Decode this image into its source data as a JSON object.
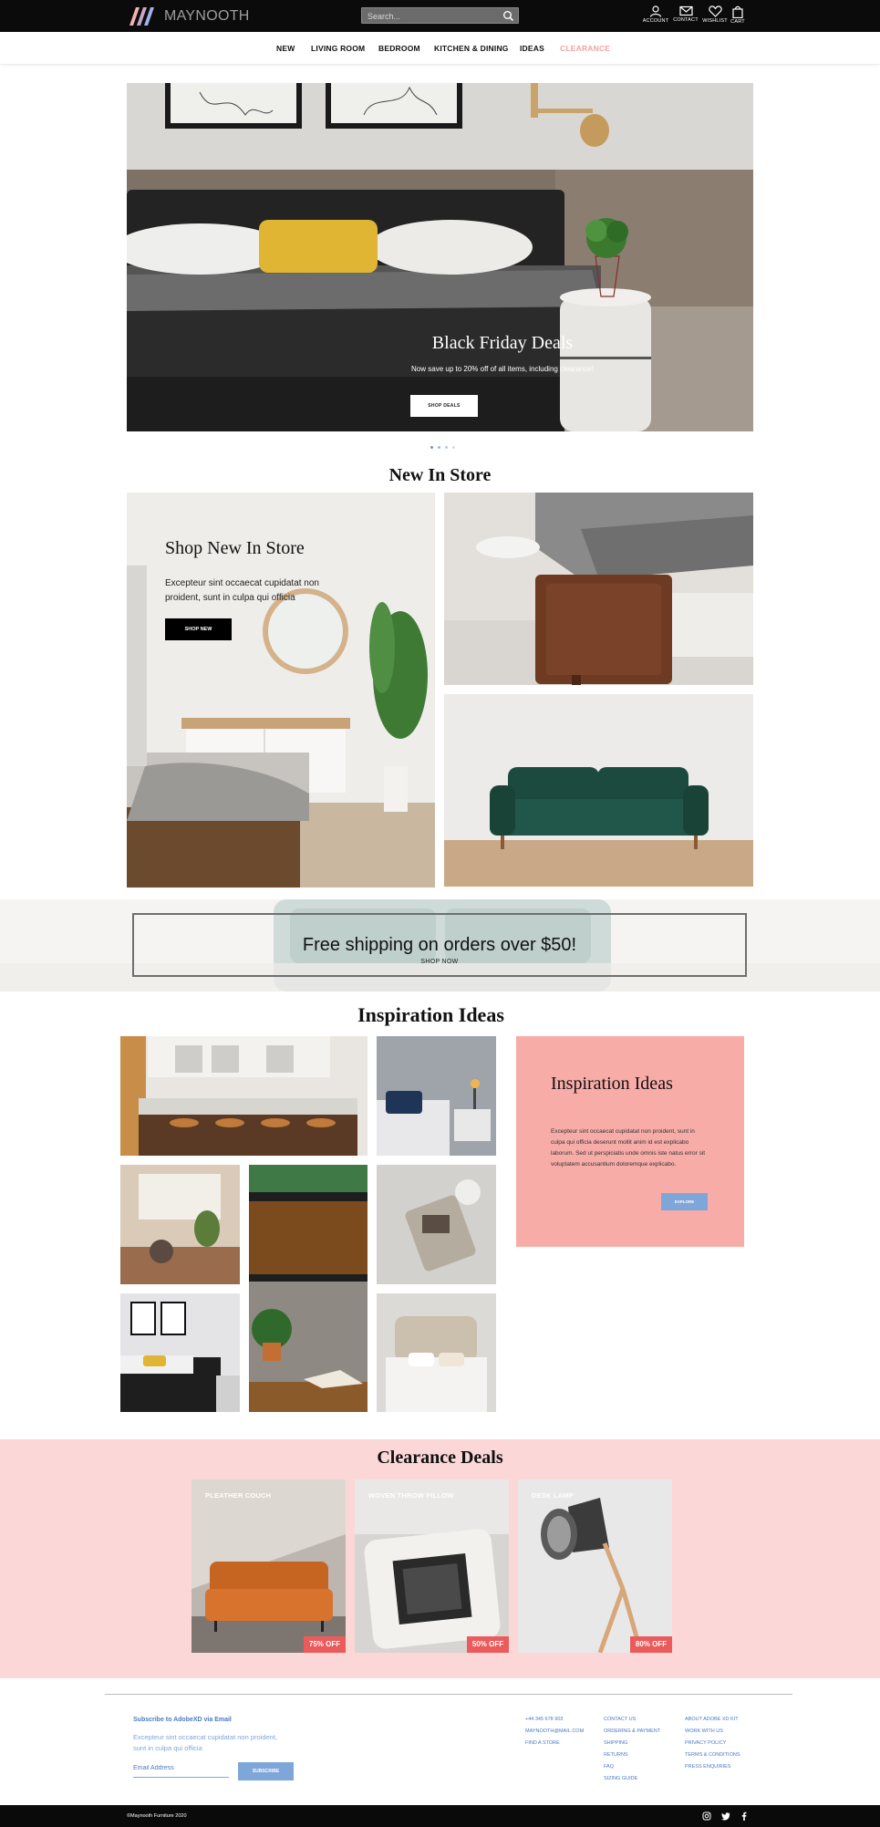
{
  "header": {
    "brand": "MAYNOOTH",
    "search_placeholder": "Search...",
    "icons": [
      {
        "name": "account-icon",
        "label": "ACCOUNT"
      },
      {
        "name": "contact-icon",
        "label": "CONTACT"
      },
      {
        "name": "wishlist-icon",
        "label": "WISHLIST"
      },
      {
        "name": "cart-icon",
        "label": "CART"
      }
    ]
  },
  "nav": {
    "items": [
      "NEW",
      "LIVING ROOM",
      "BEDROOM",
      "KITCHEN & DINING",
      "IDEAS",
      "CLEARANCE"
    ],
    "clearance_color": "#f0a3a3"
  },
  "hero": {
    "title": "Black Friday Deals",
    "subtitle": "Now save up to 20% off of all items, including clearance!",
    "button": "SHOP DEALS",
    "slides": 4,
    "active_slide": 1
  },
  "new_in_store": {
    "section_title": "New In Store",
    "heading": "Shop New In Store",
    "text": "Excepteur sint occaecat cupidatat non proident, sunt in culpa qui officia",
    "button": "SHOP NEW"
  },
  "shipping": {
    "text": "Free shipping on orders over $50!",
    "link": "SHOP NOW"
  },
  "inspiration": {
    "section_title": "Inspiration Ideas",
    "heading": "Inspiration Ideas",
    "text": "Excepteur sint occaecat cupidatat non proident, sunt in culpa qui officia deserunt mollit anim id est explicabo laborum. Sed ut perspiciatis unde omnis iste natus error sit voluptatem accusantium doloremque explicabo.",
    "button": "EXPLORE",
    "card_color": "#f7aca7"
  },
  "clearance": {
    "section_title": "Clearance Deals",
    "background": "#fcd7d7",
    "items": [
      {
        "label": "PLEATHER COUCH",
        "badge": "75% OFF"
      },
      {
        "label": "WOVEN THROW PILLOW",
        "badge": "50% OFF"
      },
      {
        "label": "DESK LAMP",
        "badge": "80% OFF"
      }
    ]
  },
  "footer": {
    "subscribe_heading": "Subscribe to AdobeXD via Email",
    "subscribe_text": "Excepteur sint occaecat cupidatat non proident, sunt in culpa qui officia",
    "email_placeholder": "Email Address",
    "subscribe_button": "SUBSCRIBE",
    "col1": [
      "+44 345 678 903",
      "MAYNOOTH@MAIL.COM",
      "FIND A STORE"
    ],
    "col2": [
      "CONTACT US",
      "ORDERING & PAYMENT",
      "SHIPPING",
      "RETURNS",
      "FAQ",
      "SIZING GUIDE"
    ],
    "col3": [
      "ABOUT ADOBE XD KIT",
      "WORK WITH US",
      "PRIVACY POLICY",
      "TERMS & CONDITIONS",
      "PRESS ENQUIRIES"
    ],
    "copyright": "©Maynooth Furniture 2020",
    "link_color": "#4a79c3"
  }
}
